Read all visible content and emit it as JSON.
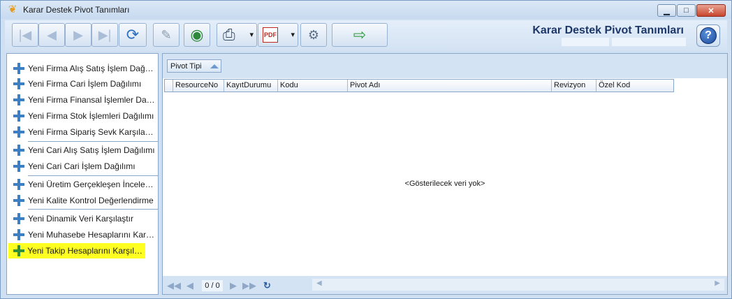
{
  "window": {
    "title": "Karar Destek Pivot Tanımları",
    "minimize_glyph": "▁",
    "maximize_glyph": "□",
    "close_glyph": "✕"
  },
  "toolbar": {
    "title": "Karar Destek Pivot Tanımları",
    "help_label": "?",
    "buttons": {
      "first": "|◀",
      "prev": "◀",
      "next": "▶",
      "last": "▶|",
      "refresh": "⟳",
      "edit": "✎",
      "web": "◉",
      "print": "⎙",
      "pdf": "PDF",
      "settings": "⚙",
      "exit": "⇨"
    },
    "dropdown_glyph": "▾"
  },
  "left_menu": {
    "items": [
      {
        "label": "Yeni Firma Alış Satış İşlem Dağılımı"
      },
      {
        "label": "Yeni Firma Cari İşlem Dağılımı"
      },
      {
        "label": "Yeni Firma Finansal İşlemler Dağıl..."
      },
      {
        "label": "Yeni Firma Stok İşlemleri Dağılımı"
      },
      {
        "label": "Yeni Firma Sipariş Sevk Karşılanma"
      },
      {
        "label": "Yeni Cari Alış Satış İşlem Dağılımı"
      },
      {
        "label": "Yeni Cari Cari İşlem Dağılımı"
      },
      {
        "label": "Yeni Üretim Gerçekleşen İnceleme"
      },
      {
        "label": "Yeni Kalite Kontrol Değerlendirme"
      },
      {
        "label": "Yeni Dinamik Veri Karşılaştır"
      },
      {
        "label": "Yeni Muhasebe Hesaplarını Karşıl..."
      },
      {
        "label": "Yeni Takip Hesaplarını Karşılaştır"
      }
    ],
    "highlighted_index": 11
  },
  "grid": {
    "group_chip_label": "Pivot Tipi",
    "columns": [
      "ResourceNo",
      "KayıtDurumu",
      "Kodu",
      "Pivot Adı",
      "Revizyon",
      "Özel Kod"
    ],
    "empty_message": "<Gösterilecek veri yok>"
  },
  "pager": {
    "count_text": "0 / 0",
    "first": "◀◀",
    "prev": "◀",
    "next": "▶",
    "last": "▶▶",
    "refresh": "↻"
  },
  "colors": {
    "highlight": "#ffff22",
    "plus_icon": "#3d7fc4",
    "title_accent": "#1d3769"
  }
}
